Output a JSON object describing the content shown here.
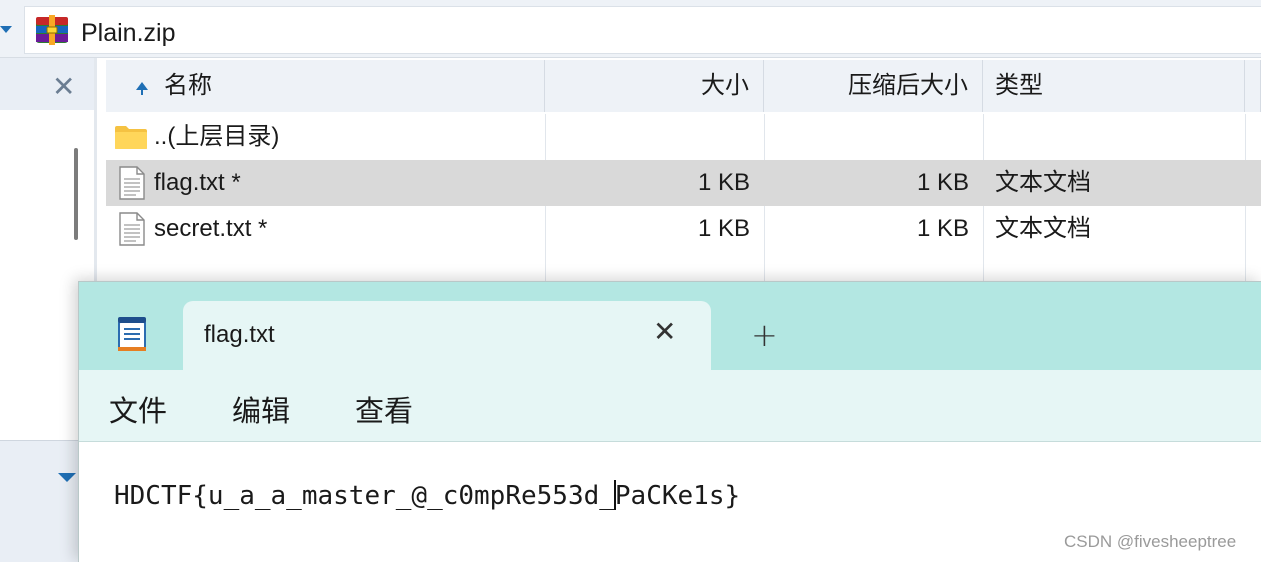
{
  "archive": {
    "address": "Plain.zip",
    "columns": {
      "name": "名称",
      "size": "大小",
      "packed": "压缩后大小",
      "type": "类型"
    },
    "rows": [
      {
        "name": "..(上层目录)",
        "size": "",
        "packed": "",
        "type": "",
        "icon": "folder-icon"
      },
      {
        "name": "flag.txt *",
        "size": "1 KB",
        "packed": "1 KB",
        "type": "文本文档",
        "icon": "text-file-icon",
        "selected": true
      },
      {
        "name": "secret.txt *",
        "size": "1 KB",
        "packed": "1 KB",
        "type": "文本文档",
        "icon": "text-file-icon"
      }
    ]
  },
  "notepad": {
    "tab_title": "flag.txt",
    "menu": {
      "file": "文件",
      "edit": "编辑",
      "view": "查看"
    },
    "content_before_caret": "HDCTF{u_a_a_master_@_c0mpRe553d_",
    "content_after_caret": "PaCKe1s}"
  },
  "watermark": "CSDN @fivesheeptree",
  "colors": {
    "titlebar": "#b3e7e2",
    "tab": "#e6f6f5",
    "selected_row": "#d9d9d9",
    "accent": "#1f6fb5"
  }
}
